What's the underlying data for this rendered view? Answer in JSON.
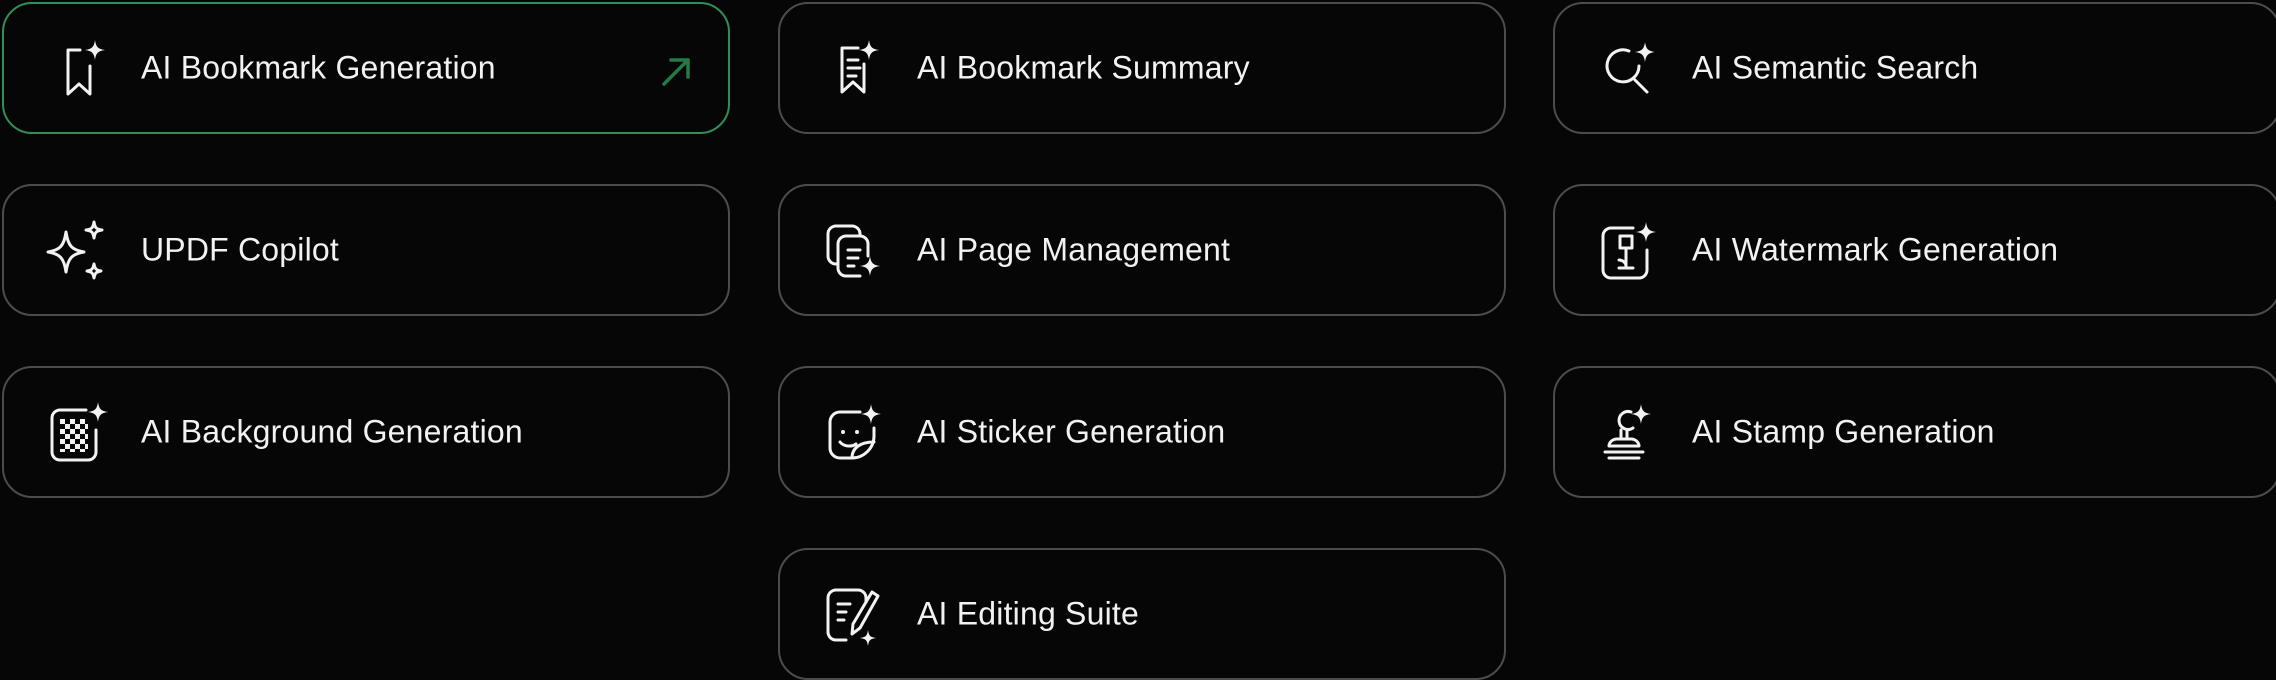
{
  "features": [
    {
      "label": "AI Bookmark Generation",
      "icon": "bookmark-sparkle-icon",
      "active": true
    },
    {
      "label": "AI Bookmark Summary",
      "icon": "bookmark-summary-icon"
    },
    {
      "label": "AI Semantic Search",
      "icon": "search-sparkle-icon"
    },
    {
      "label": "UPDF Copilot",
      "icon": "sparkles-icon"
    },
    {
      "label": "AI Page Management",
      "icon": "pages-sparkle-icon"
    },
    {
      "label": "AI Watermark Generation",
      "icon": "watermark-sparkle-icon"
    },
    {
      "label": "AI Background Generation",
      "icon": "checker-background-icon"
    },
    {
      "label": "AI Sticker Generation",
      "icon": "sticker-smile-icon"
    },
    {
      "label": "AI Stamp Generation",
      "icon": "stamp-sparkle-icon"
    },
    {
      "label": "AI Editing Suite",
      "icon": "edit-document-icon"
    }
  ],
  "colors": {
    "background": "#060606",
    "card_border": "#4c4c4c",
    "active_border": "#2f8f55",
    "arrow": "#237a45",
    "text": "#f2f2f2"
  },
  "active_arrow_icon": "arrow-up-right-icon"
}
